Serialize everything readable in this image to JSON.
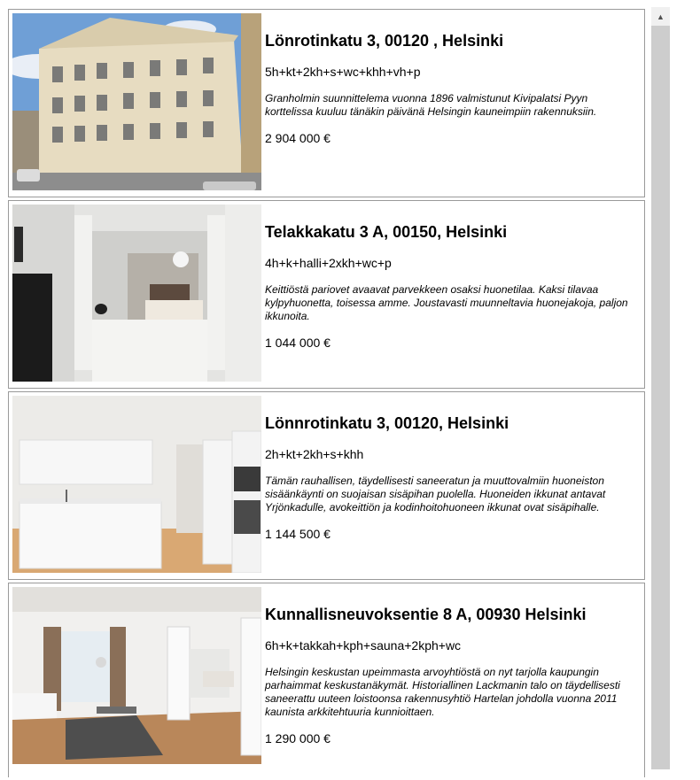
{
  "listings": [
    {
      "address": "Lönrotinkatu 3, 00120 , Helsinki",
      "rooms": "5h+kt+2kh+s+wc+khh+vh+p",
      "description": "Granholmin suunnittelema vuonna 1896 valmistunut Kivipalatsi Pyyn korttelissa kuuluu tänäkin päivänä Helsingin kauneimpiin rakennuksiin.",
      "price": "2 904 000 €"
    },
    {
      "address": "Telakkakatu 3 A, 00150, Helsinki",
      "rooms": "4h+k+halli+2xkh+wc+p",
      "description": "Keittiöstä pariovet avaavat parvekkeen osaksi huonetilaa. Kaksi tilavaa kylpyhuonetta, toisessa amme. Joustavasti muunneltavia huonejakoja, paljon ikkunoita.",
      "price": "1 044 000 €"
    },
    {
      "address": "Lönnrotinkatu 3, 00120, Helsinki",
      "rooms": "2h+kt+2kh+s+khh",
      "description": "Tämän rauhallisen, täydellisesti saneeratun ja muuttovalmiin huoneiston sisäänkäynti on suojaisan sisäpihan puolella. Huoneiden ikkunat antavat Yrjönkadulle, avokeittiön ja kodinhoitohuoneen ikkunat ovat sisäpihalle.",
      "price": "1 144 500 €"
    },
    {
      "address": "Kunnallisneuvoksentie 8 A, 00930 Helsinki",
      "rooms": "6h+k+takkah+kph+sauna+2kph+wc",
      "description": "Helsingin keskustan upeimmasta arvoyhtiöstä on nyt tarjolla kaupungin parhaimmat keskustanäkymät. Historiallinen Lackmanin talo on täydellisesti saneerattu uuteen loistoonsa rakennusyhtiö Hartelan johdolla vuonna 2011 kaunista arkkitehtuuria kunnioittaen.",
      "price": "1 290 000 €"
    }
  ],
  "scrollbar": {
    "up_icon": "scroll-up-arrow-icon"
  }
}
